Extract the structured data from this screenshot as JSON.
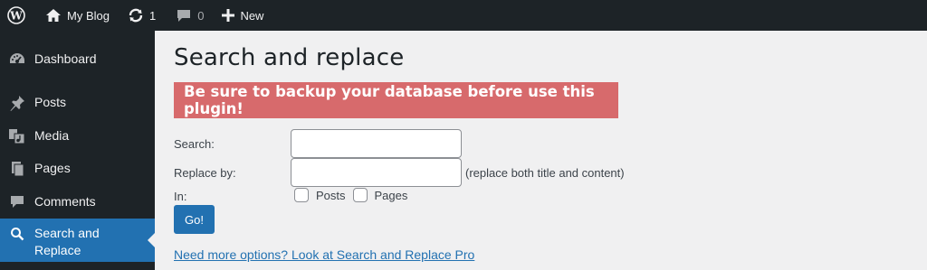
{
  "adminbar": {
    "site_name": "My Blog",
    "updates_count": "1",
    "comments_count": "0",
    "new_label": "New"
  },
  "sidebar": {
    "items": [
      {
        "label": "Dashboard",
        "icon": "dashboard-icon"
      },
      {
        "label": "Posts",
        "icon": "pin-icon"
      },
      {
        "label": "Media",
        "icon": "media-icon"
      },
      {
        "label": "Pages",
        "icon": "pages-icon"
      },
      {
        "label": "Comments",
        "icon": "comment-icon"
      },
      {
        "label_line1": "Search and",
        "label_line2": "Replace",
        "icon": "search-icon",
        "current": true
      }
    ]
  },
  "page": {
    "title": "Search and replace",
    "warning": "Be sure to backup your database before use this plugin!",
    "search_label": "Search:",
    "search_value": "",
    "replace_label": "Replace by:",
    "replace_value": "",
    "replace_hint": "(replace both title and content)",
    "in_label": "In:",
    "posts_label": "Posts",
    "pages_label": "Pages",
    "go_label": "Go!",
    "pro_link": "Need more options? Look at Search and Replace Pro"
  },
  "colors": {
    "adminbar_bg": "#1d2327",
    "accent": "#2271b1",
    "warning_bg": "#d76a6c"
  }
}
